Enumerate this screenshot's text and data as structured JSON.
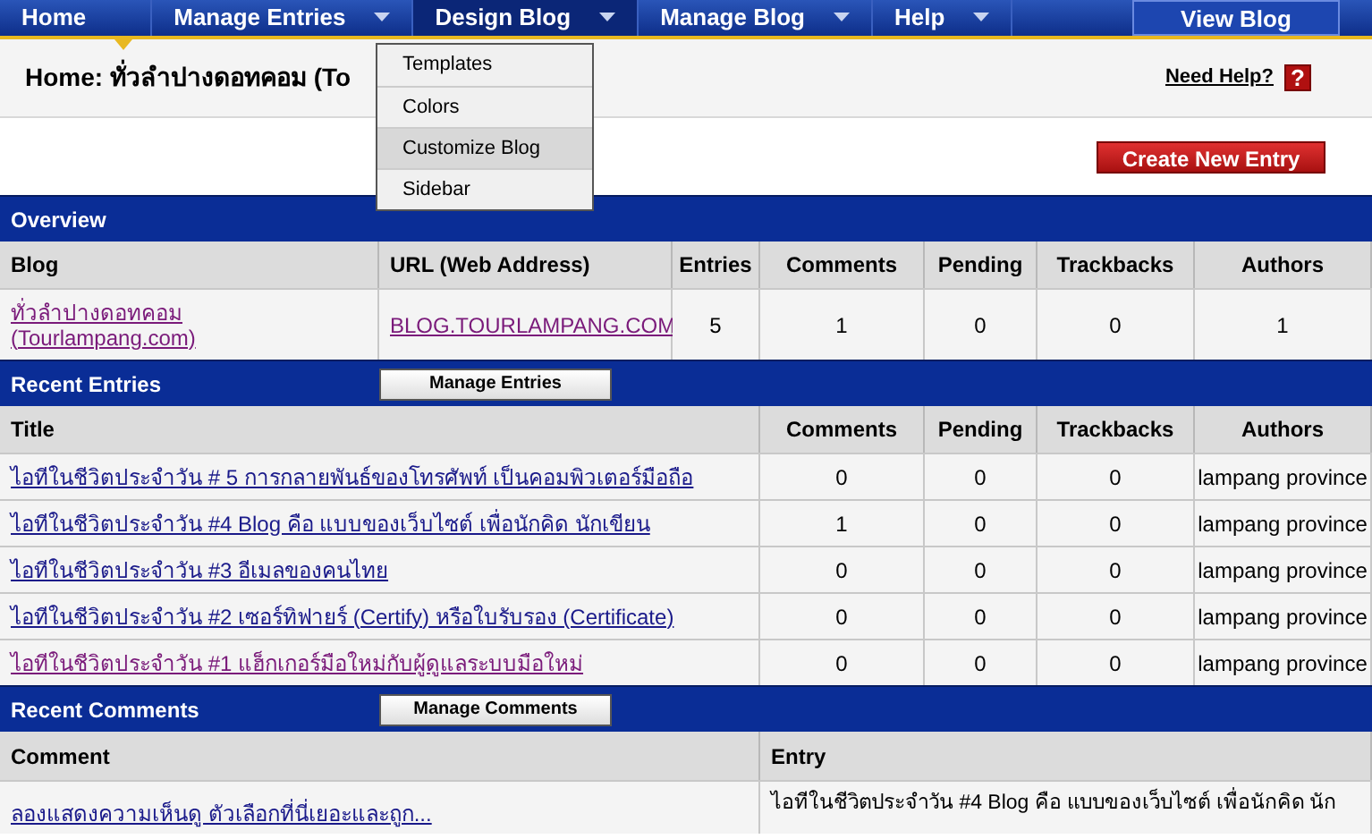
{
  "nav": {
    "items": [
      {
        "label": "Home",
        "selected": true,
        "has_menu": false,
        "expanded": false
      },
      {
        "label": "Manage Entries",
        "selected": false,
        "has_menu": true,
        "expanded": false
      },
      {
        "label": "Design Blog",
        "selected": false,
        "has_menu": true,
        "expanded": true
      },
      {
        "label": "Manage Blog",
        "selected": false,
        "has_menu": true,
        "expanded": false
      },
      {
        "label": "Help",
        "selected": false,
        "has_menu": true,
        "expanded": false
      }
    ],
    "view_button": "View Blog",
    "menu": [
      {
        "label": "Templates",
        "selected": false
      },
      {
        "label": "Colors",
        "selected": false
      },
      {
        "label": "Customize Blog",
        "selected": true
      },
      {
        "label": "Sidebar",
        "selected": false
      }
    ]
  },
  "header": {
    "title": "Home: ทั่วลำปางดอทคอม (To",
    "help_link": "Need Help?",
    "help_icon": "?"
  },
  "create_button": "Create New Entry",
  "overview": {
    "title": "Overview",
    "columns": [
      "Blog",
      "URL (Web Address)",
      "Entries",
      "Comments",
      "Pending",
      "Trackbacks",
      "Authors"
    ],
    "row": {
      "blog": "ทั่วลำปางดอทคอม (Tourlampang.com)",
      "blog_visited": true,
      "url": "BLOG.TOURLAMPANG.COM",
      "url_visited": true,
      "entries": "5",
      "comments": "1",
      "pending": "0",
      "trackbacks": "0",
      "authors": "1"
    }
  },
  "recent_entries": {
    "title": "Recent Entries",
    "button": "Manage Entries",
    "columns": [
      "Title",
      "Comments",
      "Pending",
      "Trackbacks",
      "Authors"
    ],
    "rows": [
      {
        "title": "ไอทีในชีวิตประจำวัน # 5 การกลายพันธ์ของโทรศัพท์ เป็นคอมพิวเตอร์มือถือ",
        "visited": false,
        "comments": "0",
        "pending": "0",
        "trackbacks": "0",
        "authors": "lampang province"
      },
      {
        "title": "ไอทีในชีวิตประจำวัน #4 Blog คือ แบบของเว็บไซต์ เพื่อนักคิด นักเขียน",
        "visited": false,
        "comments": "1",
        "pending": "0",
        "trackbacks": "0",
        "authors": "lampang province"
      },
      {
        "title": "ไอทีในชีวิตประจำวัน #3 อีเมลของคนไทย",
        "visited": false,
        "comments": "0",
        "pending": "0",
        "trackbacks": "0",
        "authors": "lampang province"
      },
      {
        "title": "ไอทีในชีวิตประจำวัน #2 เซอร์ทิฟายร์ (Certify) หรือใบรับรอง (Certificate)",
        "visited": false,
        "comments": "0",
        "pending": "0",
        "trackbacks": "0",
        "authors": "lampang province"
      },
      {
        "title": "ไอทีในชีวิตประจำวัน #1 แฮ็กเกอร์มือใหม่กับผู้ดูแลระบบมือใหม่",
        "visited": true,
        "comments": "0",
        "pending": "0",
        "trackbacks": "0",
        "authors": "lampang province"
      }
    ]
  },
  "recent_comments": {
    "title": "Recent Comments",
    "button": "Manage Comments",
    "columns": [
      "Comment",
      "Entry"
    ],
    "rows": [
      {
        "comment": "ลองแสดงความเห็นดู ตัวเลือกที่นี่เยอะและถูก...",
        "visited": false,
        "entry": "ไอทีในชีวิตประจำวัน #4 Blog คือ แบบของเว็บไซต์ เพื่อนักคิด นัก"
      }
    ]
  }
}
